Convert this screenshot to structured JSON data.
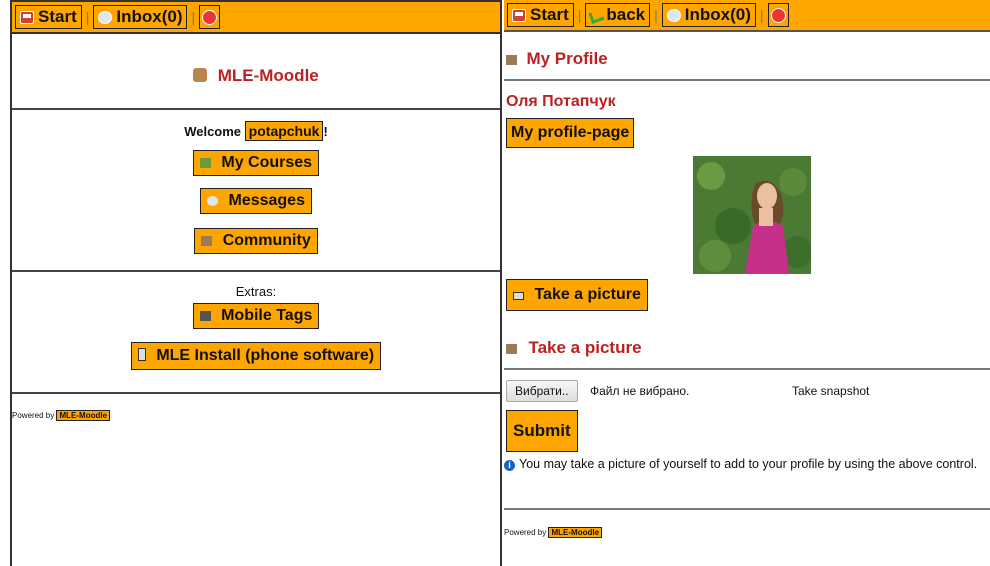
{
  "left": {
    "topbar": {
      "start_label": "Start",
      "inbox_label": "Inbox(0)"
    },
    "site_title": "MLE-Moodle",
    "welcome_prefix": "Welcome",
    "username": "potapchuk",
    "welcome_suffix": "!",
    "menu": [
      {
        "label": "My Courses",
        "icon": "courses-icon"
      },
      {
        "label": "Messages",
        "icon": "messages-icon"
      },
      {
        "label": "Community",
        "icon": "community-icon"
      }
    ],
    "extras_label": "Extras:",
    "extras": [
      {
        "label": "Mobile Tags",
        "icon": "qr-icon"
      },
      {
        "label": "MLE Install (phone software)",
        "icon": "phone-icon"
      }
    ],
    "footer": {
      "powered_by": "Powered by",
      "badge": "MLE-Moodle"
    }
  },
  "right": {
    "topbar": {
      "start_label": "Start",
      "back_label": "back",
      "inbox_label": "Inbox(0)"
    },
    "profile_heading": "My Profile",
    "user_name": "Оля Потапчук",
    "profile_page_button": "My profile-page",
    "take_picture_button": "Take a picture",
    "take_picture_heading": "Take a picture",
    "file_button": "Вибрати..",
    "file_status": "Файл не вибрано.",
    "take_snapshot": "Take snapshot",
    "submit_label": "Submit",
    "info_text": "You may take a picture of yourself to add to your profile by using the above control.",
    "footer": {
      "powered_by": "Powered by",
      "badge": "MLE-Moodle"
    }
  },
  "colors": {
    "accent": "#ffa500",
    "heading": "#b22222"
  }
}
